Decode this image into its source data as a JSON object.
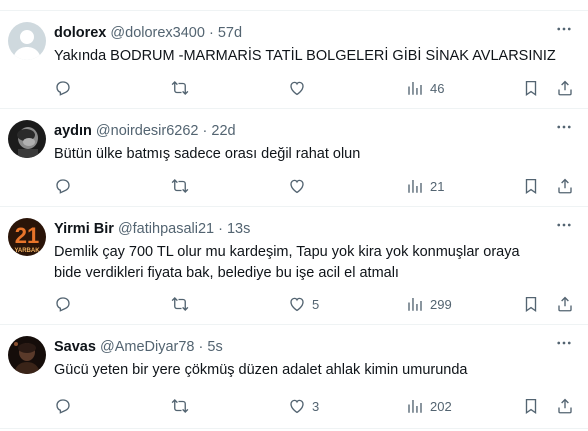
{
  "tweets": [
    {
      "name": "dolorex",
      "handle": "@dolorex3400",
      "dot": "·",
      "time": "57d",
      "text": "Yakında BODRUM -MARMARİS TATİL BOLGELERİ GİBİ SİNAK AVLARSINIZ",
      "likes": "",
      "views": "46"
    },
    {
      "name": "aydın",
      "handle": "@noirdesir6262",
      "dot": "·",
      "time": "22d",
      "text": "Bütün ülke batmış sadece orası değil rahat olun",
      "likes": "",
      "views": "21"
    },
    {
      "name": "Yirmi Bir",
      "handle": "@fatihpasali21",
      "dot": "·",
      "time": "13s",
      "text": "Demlik çay 700 TL olur mu kardeşim, Tapu yok kira yok konmuşlar oraya\nbide verdikleri fiyata bak, belediye bu işe acil el atmalı",
      "likes": "5",
      "views": "299",
      "avatar_text": "21",
      "avatar_subtext": "YARBAK"
    },
    {
      "name": "Savas",
      "handle": "@AmeDiyar78",
      "dot": "·",
      "time": "5s",
      "text": "Gücü yeten bir yere çökmüş düzen adalet ahlak kimin umurunda",
      "likes": "3",
      "views": "202"
    }
  ],
  "icons": {
    "more": "more-icon",
    "reply": "reply-icon",
    "retweet": "retweet-icon",
    "like": "like-icon",
    "views": "views-icon",
    "bookmark": "bookmark-icon",
    "share": "share-icon"
  },
  "colors": {
    "text": "#0f1419",
    "secondary": "#536471",
    "divider": "#eff3f4"
  }
}
